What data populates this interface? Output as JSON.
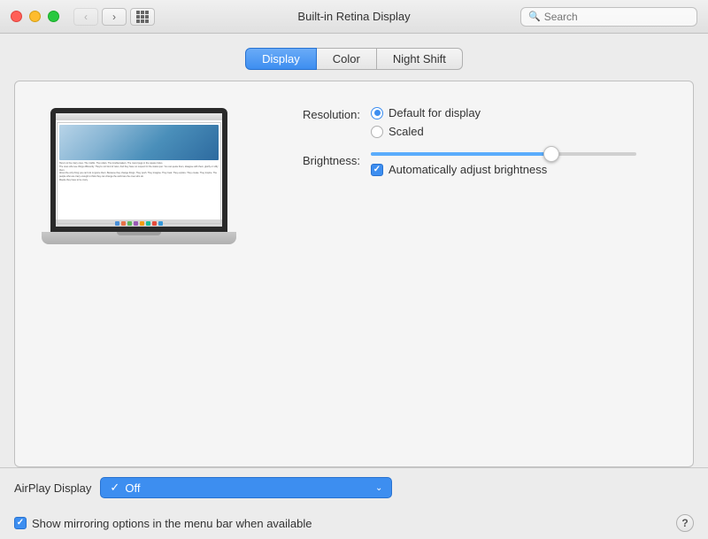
{
  "titlebar": {
    "title": "Built-in Retina Display",
    "search_placeholder": "Search"
  },
  "tabs": [
    {
      "id": "display",
      "label": "Display",
      "active": true
    },
    {
      "id": "color",
      "label": "Color",
      "active": false
    },
    {
      "id": "night-shift",
      "label": "Night Shift",
      "active": false
    }
  ],
  "resolution": {
    "label": "Resolution:",
    "options": [
      {
        "id": "default",
        "label": "Default for display",
        "checked": true
      },
      {
        "id": "scaled",
        "label": "Scaled",
        "checked": false
      }
    ]
  },
  "brightness": {
    "label": "Brightness:",
    "value": 68,
    "auto_adjust": {
      "label": "Automatically adjust brightness",
      "checked": true
    }
  },
  "airplay": {
    "label": "AirPlay Display",
    "value": "Off",
    "checkmark": "✓"
  },
  "mirroring": {
    "label": "Show mirroring options in the menu bar when available",
    "checked": true
  },
  "help": {
    "label": "?"
  },
  "screen_text": {
    "line1": "Here's to the crazy ones. The misfits. The rebels. The troublemakers. The round pegs in the square holes.",
    "line2": "The ones who see things differently. They're not fond of rules. And they have no respect for the status quo. You can quote them, disagree with them, glorify or vilify them.",
    "line3": "About the only thing you can't do is ignore them. Because they change things. They push. They imagine. They heal. They explore. They create. They inspire. The people who are crazy enough to think they can change the world are the ones who do.",
    "line4": "Maybe they have to be crazy."
  }
}
